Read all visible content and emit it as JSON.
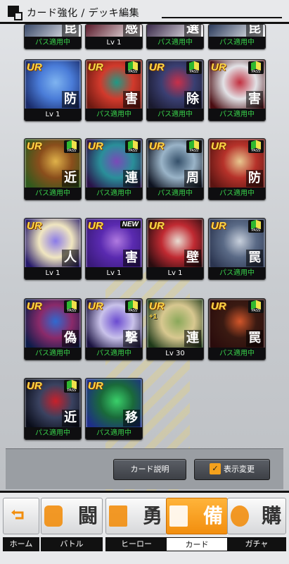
{
  "header": {
    "title": "カード強化 / デッキ編集"
  },
  "rows": [
    [
      {
        "rar": "UR",
        "kanji": "防",
        "foot": "Lv 1",
        "pass": false,
        "badge": "none",
        "colors": [
          "#1a2c6b",
          "#7fb4f0",
          "#4a7cd8"
        ]
      },
      {
        "rar": "UR",
        "kanji": "害",
        "foot": "パス適用中",
        "pass": true,
        "badge": "pass",
        "colors": [
          "#6d1a12",
          "#1f9a86",
          "#d23a2c"
        ]
      },
      {
        "rar": "UR",
        "kanji": "除",
        "foot": "パス適用中",
        "pass": true,
        "badge": "pass",
        "colors": [
          "#1a1a2e",
          "#c8304a",
          "#3a3f72"
        ]
      },
      {
        "rar": "UR",
        "kanji": "害",
        "foot": "パス適用中",
        "pass": true,
        "badge": "pass",
        "colors": [
          "#4a0d12",
          "#c23040",
          "#e2e2e6"
        ]
      }
    ],
    [
      {
        "rar": "UR",
        "kanji": "近",
        "foot": "パス適用中",
        "pass": true,
        "badge": "pass",
        "colors": [
          "#2f5a1d",
          "#e0b24a",
          "#8a4e1c"
        ]
      },
      {
        "rar": "UR",
        "kanji": "連",
        "foot": "パス適用中",
        "pass": true,
        "badge": "pass",
        "colors": [
          "#2a1248",
          "#7a4ab8",
          "#2a8f9a"
        ]
      },
      {
        "rar": "UR",
        "kanji": "周",
        "foot": "パス適用中",
        "pass": true,
        "badge": "pass",
        "colors": [
          "#0d1220",
          "#35506a",
          "#9ab4c8"
        ]
      },
      {
        "rar": "UR",
        "kanji": "防",
        "foot": "パス適用中",
        "pass": true,
        "badge": "pass",
        "colors": [
          "#5b1512",
          "#e8c890",
          "#b6322a"
        ]
      }
    ],
    [
      {
        "rar": "UR",
        "kanji": "人",
        "foot": "Lv 1",
        "pass": false,
        "badge": "none",
        "colors": [
          "#261a6b",
          "#8a7ae8",
          "#f0e6c0"
        ]
      },
      {
        "rar": "UR",
        "kanji": "害",
        "foot": "Lv 1",
        "pass": false,
        "badge": "new",
        "colors": [
          "#3a1a7a",
          "#b07ae0",
          "#5a2ab0"
        ]
      },
      {
        "rar": "UR",
        "kanji": "壁",
        "foot": "Lv 1",
        "pass": false,
        "badge": "none",
        "colors": [
          "#2a0d10",
          "#e8dcd2",
          "#c02a32"
        ]
      },
      {
        "rar": "UR",
        "kanji": "罠",
        "foot": "パス適用中",
        "pass": true,
        "badge": "pass",
        "colors": [
          "#2b3550",
          "#c8d0dc",
          "#5a6a86"
        ]
      }
    ],
    [
      {
        "rar": "UR",
        "kanji": "偽",
        "foot": "パス適用中",
        "pass": true,
        "badge": "pass",
        "colors": [
          "#0d1c4a",
          "#2f6ad0",
          "#8a2a6a"
        ]
      },
      {
        "rar": "UR",
        "kanji": "撃",
        "foot": "パス適用中",
        "pass": true,
        "badge": "pass",
        "colors": [
          "#1a1240",
          "#6a4ad0",
          "#c9c2ea"
        ]
      },
      {
        "rar": "UR",
        "kanji": "連",
        "foot": "Lv 30",
        "pass": false,
        "badge": "none",
        "plus": "+1",
        "colors": [
          "#1f3a1a",
          "#8aa85a",
          "#d8c890"
        ]
      },
      {
        "rar": "UR",
        "kanji": "罠",
        "foot": "パス適用中",
        "pass": true,
        "badge": "pass",
        "colors": [
          "#2a0c0c",
          "#d2562a",
          "#3a1a12"
        ]
      }
    ],
    [
      {
        "rar": "UR",
        "kanji": "近",
        "foot": "パス適用中",
        "pass": true,
        "badge": "pass",
        "colors": [
          "#0a0d1a",
          "#c8202a",
          "#3a4260"
        ]
      },
      {
        "rar": "UR",
        "kanji": "移",
        "foot": "パス適用中",
        "pass": true,
        "badge": "none",
        "colors": [
          "#1e2e8a",
          "#3ad06a",
          "#1a6a3a"
        ]
      }
    ]
  ],
  "top_partial": [
    {
      "foot": "パス適用中",
      "pass": true,
      "kanji": "昆",
      "colors": [
        "#3a4a6a",
        "#ffffff"
      ]
    },
    {
      "foot": "Lv 1",
      "pass": false,
      "kanji": "感",
      "colors": [
        "#5a1a2a",
        "#ffffff"
      ]
    },
    {
      "foot": "パス適用中",
      "pass": true,
      "kanji": "選",
      "colors": [
        "#3a2a4a",
        "#ffffff"
      ]
    },
    {
      "foot": "パス適用中",
      "pass": true,
      "kanji": "昆",
      "colors": [
        "#2a3a5a",
        "#ffffff"
      ]
    }
  ],
  "pass_badge_text": "PASS",
  "new_badge_text": "NEW",
  "actions": {
    "card_desc": "カード説明",
    "display_change": "表示変更",
    "check_mark": "✓"
  },
  "nav": [
    {
      "kanji": "",
      "label": "ホーム",
      "icon": "back-arrow-icon"
    },
    {
      "kanji": "闘",
      "label": "バトル",
      "icon": "gamepad-icon"
    },
    {
      "kanji": "勇",
      "label": "ヒーロー",
      "icon": "hero-icon"
    },
    {
      "kanji": "備",
      "label": "カード",
      "icon": "cards-icon",
      "active": true
    },
    {
      "kanji": "購",
      "label": "ガチャ",
      "icon": "shop-icon"
    }
  ]
}
